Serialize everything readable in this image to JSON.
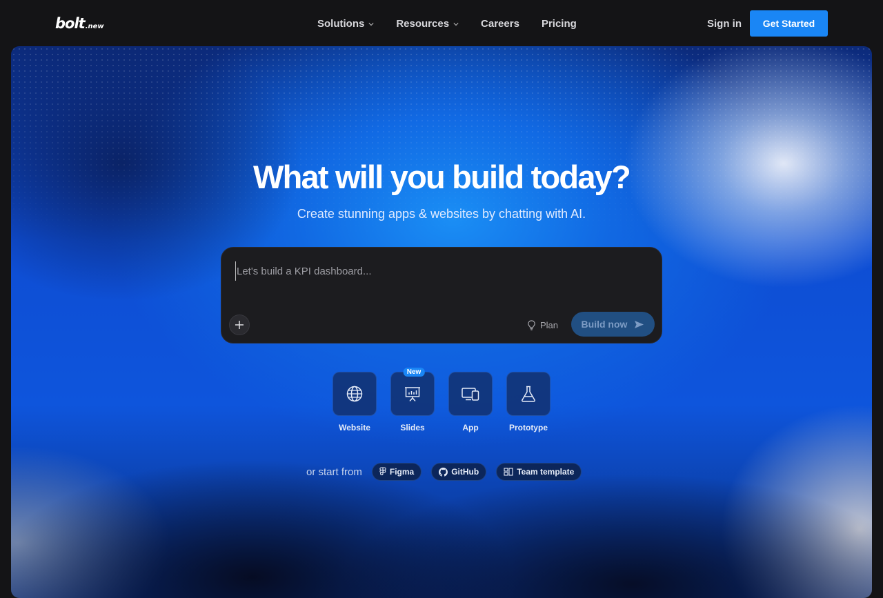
{
  "nav": {
    "logo_main": "bolt",
    "logo_sub": ".new",
    "links": [
      {
        "label": "Solutions",
        "dropdown": true
      },
      {
        "label": "Resources",
        "dropdown": true
      },
      {
        "label": "Careers",
        "dropdown": false
      },
      {
        "label": "Pricing",
        "dropdown": false
      }
    ],
    "signin": "Sign in",
    "cta": "Get Started"
  },
  "hero": {
    "title": "What will you build today?",
    "subtitle": "Create stunning apps & websites by chatting with AI.",
    "prompt": {
      "placeholder": "Let's build a KPI dashboard...",
      "plan_label": "Plan",
      "build_label": "Build now"
    },
    "categories": [
      {
        "label": "Website",
        "icon": "globe-icon"
      },
      {
        "label": "Slides",
        "icon": "presentation-icon",
        "badge": "New"
      },
      {
        "label": "App",
        "icon": "devices-icon"
      },
      {
        "label": "Prototype",
        "icon": "flask-icon"
      }
    ],
    "start_from": {
      "label": "or start from",
      "options": [
        {
          "label": "Figma",
          "icon": "figma-icon"
        },
        {
          "label": "GitHub",
          "icon": "github-icon"
        },
        {
          "label": "Team template",
          "icon": "template-icon"
        }
      ]
    }
  },
  "colors": {
    "accent": "#1a86f5",
    "background": "#141416",
    "prompt_bg": "#1c1c1f"
  }
}
